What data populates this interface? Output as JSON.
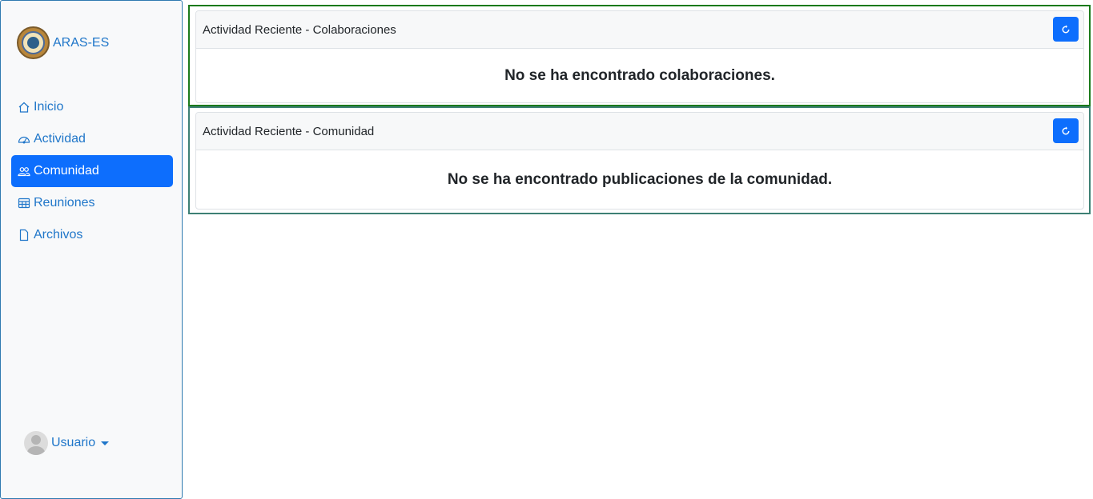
{
  "sidebar": {
    "brand": {
      "label": "ARAS-ES",
      "logo": "institution-seal-logo"
    },
    "items": [
      {
        "label": "Inicio",
        "icon": "home-icon",
        "active": false
      },
      {
        "label": "Actividad",
        "icon": "speedometer-icon",
        "active": false
      },
      {
        "label": "Comunidad",
        "icon": "people-icon",
        "active": true
      },
      {
        "label": "Reuniones",
        "icon": "table-icon",
        "active": false
      },
      {
        "label": "Archivos",
        "icon": "file-icon",
        "active": false
      }
    ],
    "user": {
      "label": "Usuario",
      "icon": "avatar-icon"
    }
  },
  "panels": {
    "colaboraciones": {
      "title": "Actividad Reciente - Colaboraciones",
      "empty_message": "No se ha encontrado colaboraciones.",
      "button_icon": "refresh-icon"
    },
    "comunidad": {
      "title": "Actividad Reciente - Comunidad",
      "empty_message": "No se ha encontrado publicaciones de la comunidad.",
      "button_icon": "refresh-icon"
    }
  },
  "colors": {
    "accent": "#0d6efd",
    "link": "#1f76c9",
    "panel_1_border": "#1b7a1b",
    "panel_2_border": "#3d8074"
  }
}
